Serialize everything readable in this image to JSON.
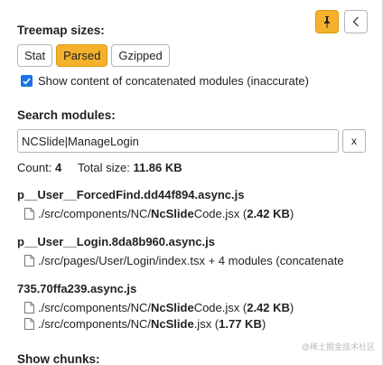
{
  "header": {
    "treemap_title": "Treemap sizes:",
    "pin_icon": "pin-icon",
    "collapse_icon": "chevron-left-icon"
  },
  "size_options": [
    {
      "label": "Stat",
      "active": false
    },
    {
      "label": "Parsed",
      "active": true
    },
    {
      "label": "Gzipped",
      "active": false
    }
  ],
  "concat_checkbox": {
    "label": "Show content of concatenated modules (inaccurate)",
    "checked": true
  },
  "search": {
    "title": "Search modules:",
    "value": "NCSlide|ManageLogin",
    "clear_label": "x"
  },
  "summary": {
    "count_label": "Count:",
    "count_value": "4",
    "size_label": "Total size:",
    "size_value": "11.86 KB"
  },
  "chunks": [
    {
      "name": "p__User__ForcedFind.dd44f894.async.js",
      "modules": [
        {
          "prefix": "./src/components/NC/",
          "match": "NcSlide",
          "suffix": "Code.jsx (",
          "size": "2.42 KB",
          "close": ")"
        }
      ]
    },
    {
      "name": "p__User__Login.8da8b960.async.js",
      "modules": [
        {
          "prefix": "./src/pages/User/Login/index.tsx + 4 modules (concatenate",
          "match": "",
          "suffix": "",
          "size": "",
          "close": ""
        }
      ]
    },
    {
      "name": "735.70ffa239.async.js",
      "modules": [
        {
          "prefix": "./src/components/NC/",
          "match": "NcSlide",
          "suffix": "Code.jsx (",
          "size": "2.42 KB",
          "close": ")"
        },
        {
          "prefix": "./src/components/NC/",
          "match": "NcSlide",
          "suffix": ".jsx (",
          "size": "1.77 KB",
          "close": ")"
        }
      ]
    }
  ],
  "show_chunks_title": "Show chunks:",
  "watermark": "@稀土掘金技术社区",
  "colors": {
    "accent": "#f5b12c",
    "checkbox": "#1a73e8"
  }
}
